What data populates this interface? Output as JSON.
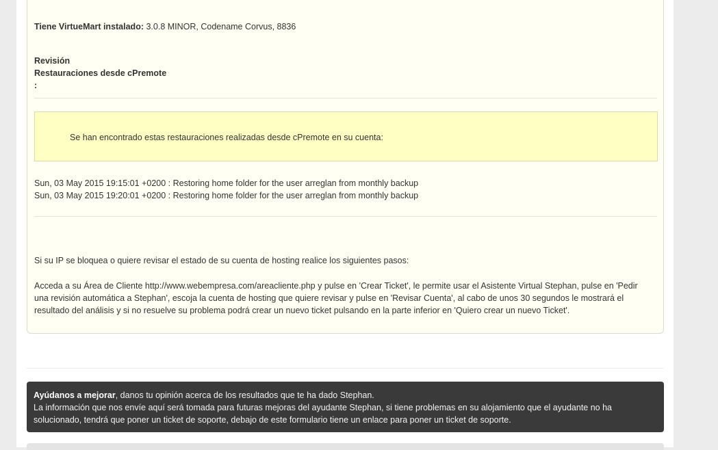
{
  "result": {
    "vm_label": "Tiene VirtueMart instalado:",
    "vm_value": " 3.0.8 MINOR, Codename Corvus, 8836",
    "revision_title": "Revisión",
    "restorations_title": "Restauraciones desde cPremote",
    "colon": ":",
    "notice": "Se han encontrado estas restauraciones realizadas desde cPremote en su cuenta:",
    "log": [
      "Sun, 03 May 2015 19:15:01 +0200 : Restoring home folder for the user arreglan from monthly backup",
      "Sun, 03 May 2015 19:20:01 +0200 : Restoring home folder for the user arreglan from monthly backup"
    ],
    "help_intro": "Si su IP se bloquea o quiere revisar el estado de su cuenta de hosting realice los siguientes pasos:",
    "help_steps": "Acceda a su Área de Cliente http://www.webempresa.com/areacliente.php y pulse en 'Crear Ticket', le permite usar el Asistente Virtual Stephan, pulse en 'Pedir una revisión automática a Stephan', escoja la cuenta de hosting que quiere revisar y pulse en 'Revisar Cuenta', al cabo de unos 30 segundos le mostrará el resultado del análisis y si no resuelve su problema podrá crear un nuevo ticket pulsando en la parte inferior en 'Quiero crear un nuevo Ticket'."
  },
  "feedback": {
    "title": "Ayúdanos a mejorar",
    "title_suffix": ", danos tu opinión acerca de los resultados que te ha dado Stephan.",
    "body": "La información que nos envíe aquí será tomada para futuras mejoras del ayudante Stephan, si tiene problemas en su alojamiento que el ayudante no ha solucionado, tendrá que poner un ticket de soporte, debajo de este formulario tiene un enlace para poner un ticket de soporte."
  }
}
